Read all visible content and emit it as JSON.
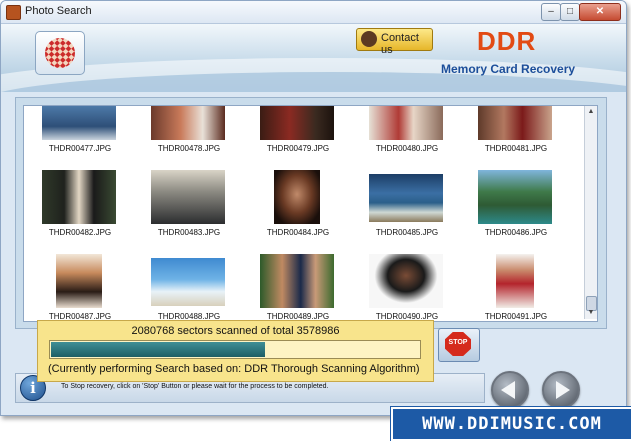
{
  "window": {
    "title": "Photo Search",
    "controls": {
      "minimize": "–",
      "maximize": "□",
      "close": "✕"
    }
  },
  "header": {
    "contact_label": "Contact us",
    "brand": "DDR",
    "subtitle": "Memory Card Recovery",
    "colors": {
      "brand": "#e24a14",
      "subtitle": "#1c4e9a"
    }
  },
  "thumbnails": [
    {
      "file": "THDR00477.JPG",
      "icon": "photo-thumbnail"
    },
    {
      "file": "THDR00478.JPG",
      "icon": "photo-thumbnail"
    },
    {
      "file": "THDR00479.JPG",
      "icon": "photo-thumbnail"
    },
    {
      "file": "THDR00480.JPG",
      "icon": "photo-thumbnail"
    },
    {
      "file": "THDR00481.JPG",
      "icon": "photo-thumbnail"
    },
    {
      "file": "THDR00482.JPG",
      "icon": "photo-thumbnail"
    },
    {
      "file": "THDR00483.JPG",
      "icon": "photo-thumbnail"
    },
    {
      "file": "THDR00484.JPG",
      "icon": "photo-thumbnail"
    },
    {
      "file": "THDR00485.JPG",
      "icon": "photo-thumbnail"
    },
    {
      "file": "THDR00486.JPG",
      "icon": "photo-thumbnail"
    },
    {
      "file": "THDR00487.JPG",
      "icon": "photo-thumbnail"
    },
    {
      "file": "THDR00488.JPG",
      "icon": "photo-thumbnail"
    },
    {
      "file": "THDR00489.JPG",
      "icon": "photo-thumbnail"
    },
    {
      "file": "THDR00490.JPG",
      "icon": "photo-thumbnail"
    },
    {
      "file": "THDR00491.JPG",
      "icon": "photo-thumbnail"
    }
  ],
  "progress": {
    "sectors_text": "2080768 sectors scanned of total 3578986",
    "scanned": 2080768,
    "total": 3578986,
    "algorithm_text": "(Currently performing Search based on:  DDR Thorough Scanning Algorithm)"
  },
  "stop_button": {
    "label": "STOP"
  },
  "status": {
    "text": "To Stop recovery, click on 'Stop' Button or please wait for the process to be completed.",
    "info_glyph": "i"
  },
  "watermark": "WWW.DDIMUSIC.COM"
}
